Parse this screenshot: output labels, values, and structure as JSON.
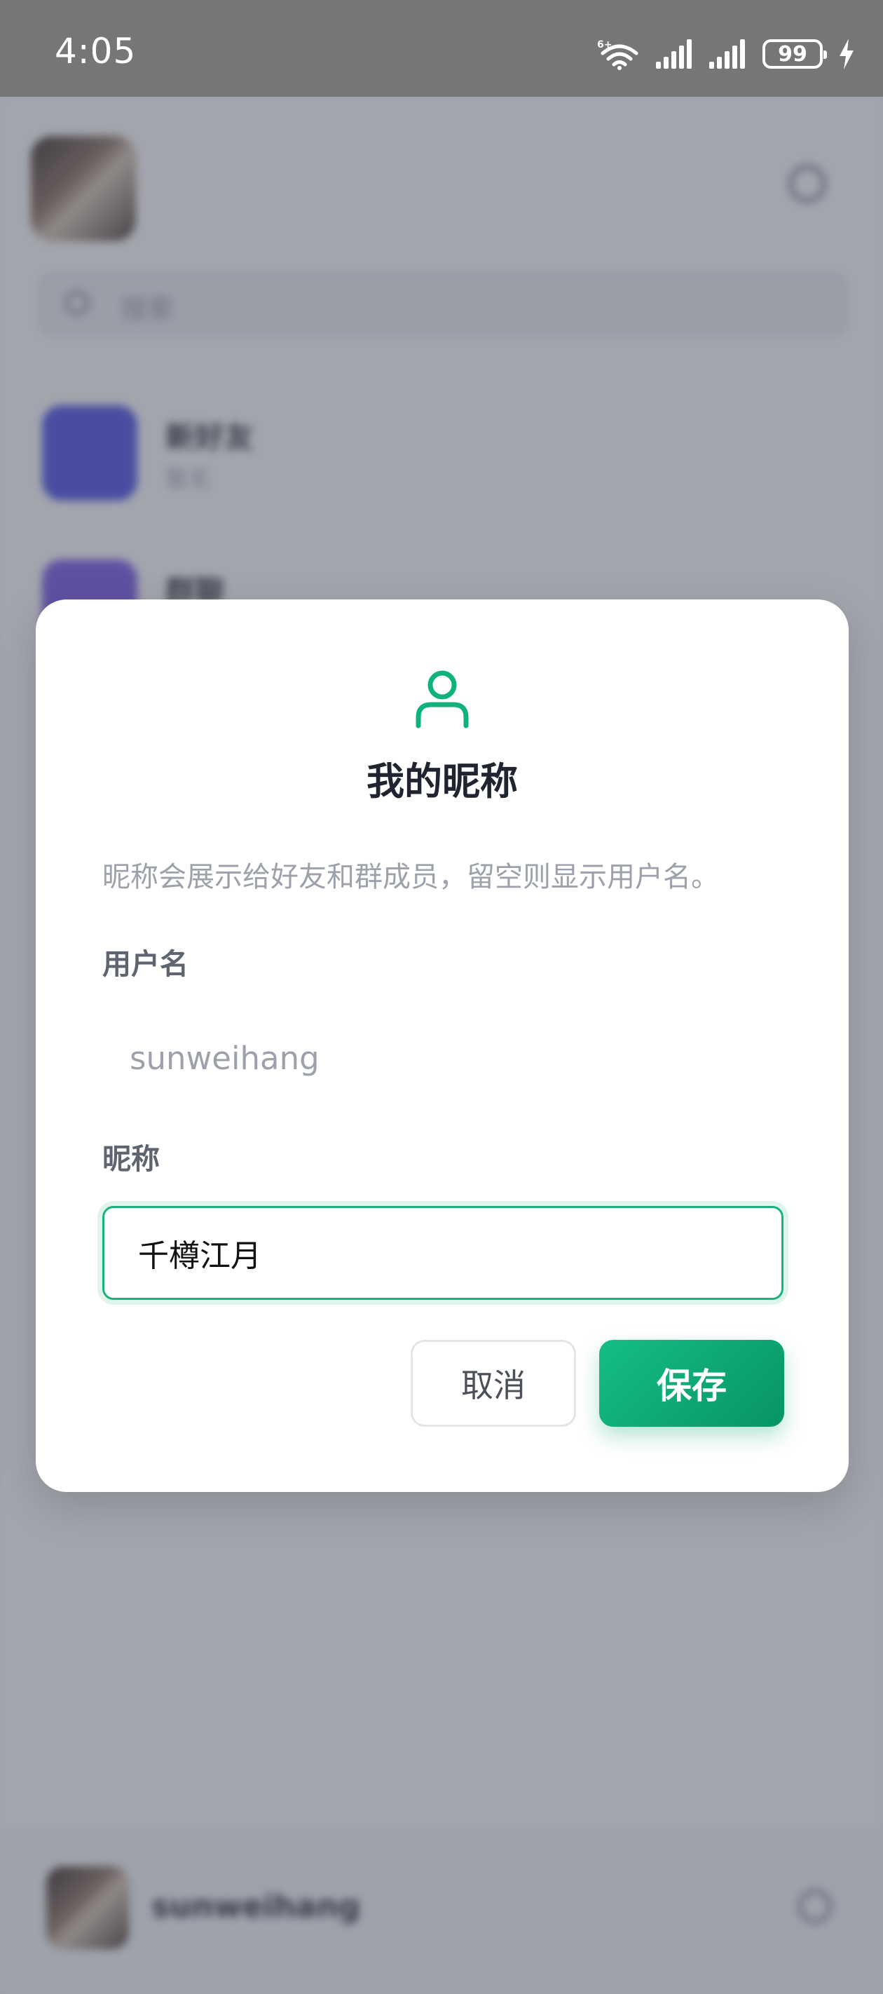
{
  "status_bar": {
    "time": "4:05",
    "battery": "99",
    "wifi_badge": "6+"
  },
  "background": {
    "search_placeholder": "搜索",
    "rows": [
      {
        "title": "新好友",
        "subtitle": "暂无",
        "color": "#4b4ee6"
      },
      {
        "title": "群聊",
        "subtitle": "",
        "color": "#7a55e8"
      }
    ],
    "bottom_username": "sunweihang"
  },
  "dialog": {
    "title": "我的昵称",
    "description": "昵称会展示给好友和群成员，留空则显示用户名。",
    "username_label": "用户名",
    "username_value": "sunweihang",
    "nickname_label": "昵称",
    "nickname_value": "千樽江月",
    "cancel_label": "取消",
    "save_label": "保存"
  },
  "colors": {
    "accent": "#10b27b",
    "accent_dark": "#079467",
    "status_bar": "#767676"
  }
}
